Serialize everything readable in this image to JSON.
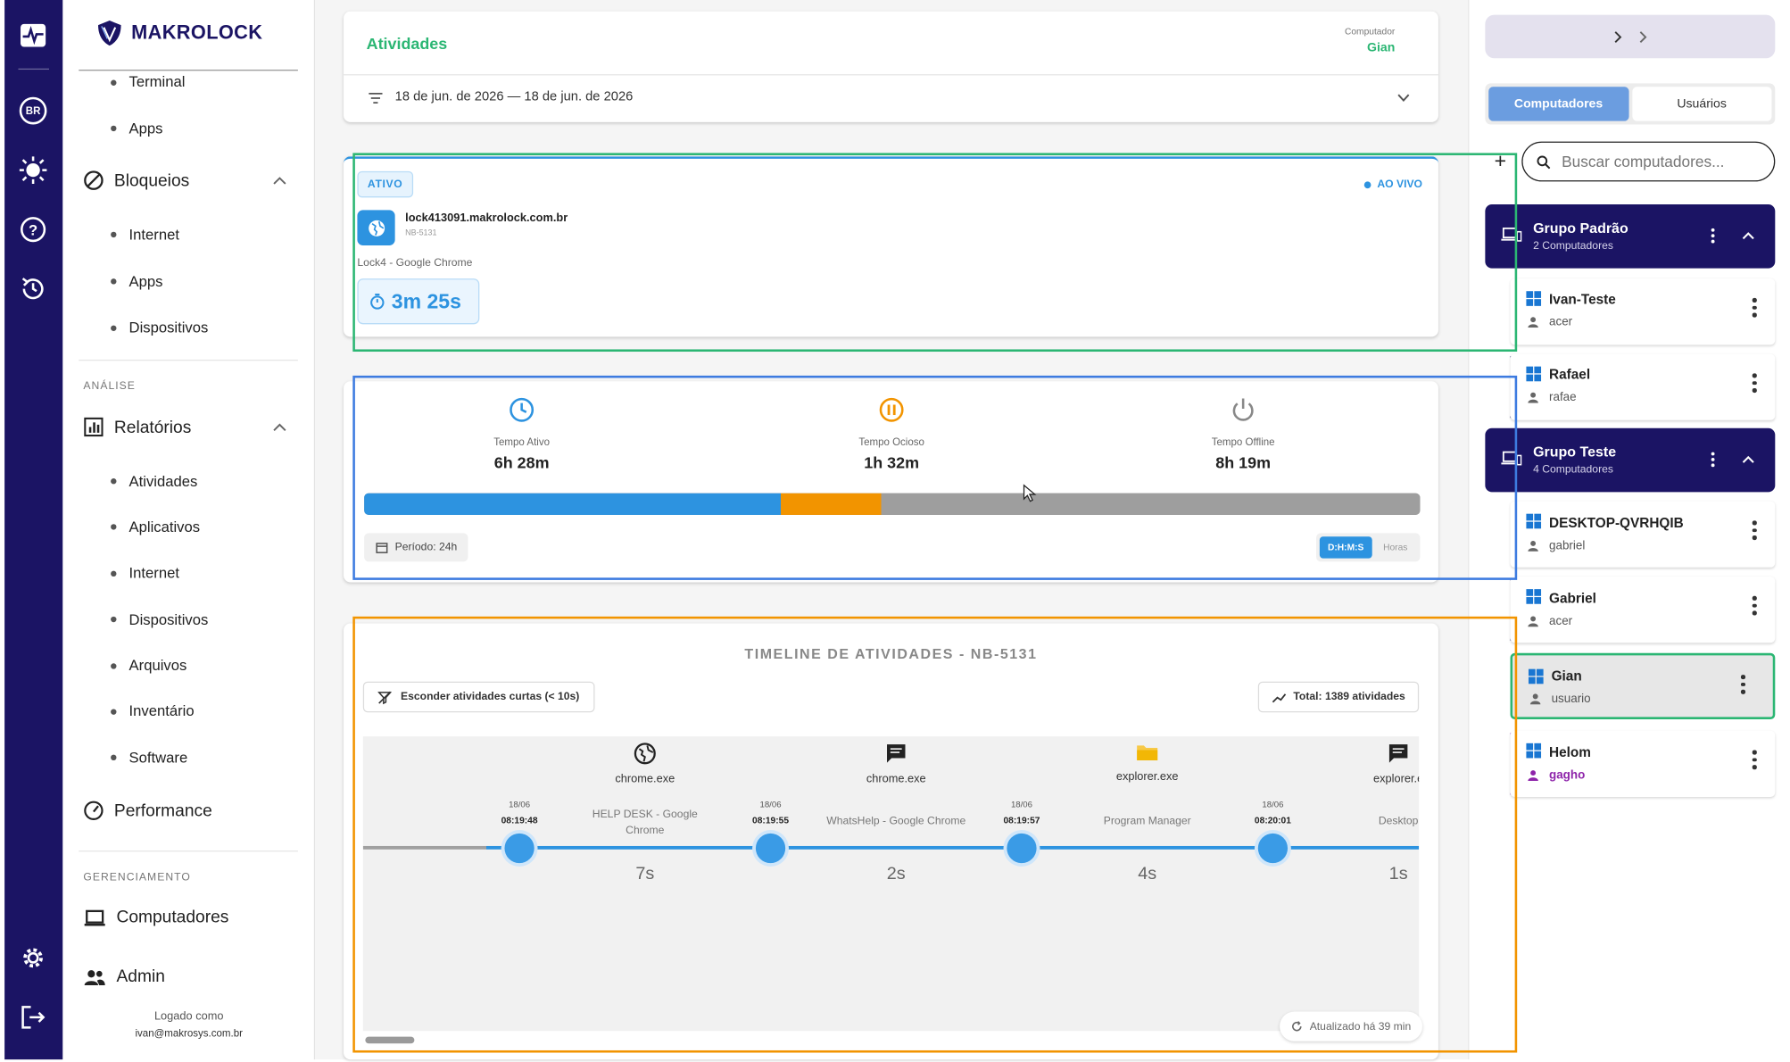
{
  "brand": {
    "name": "MAKROLOCK"
  },
  "rail": {
    "lang_badge": "BR"
  },
  "sidebar": {
    "items_top": [
      {
        "label": "Terminal"
      },
      {
        "label": "Apps"
      }
    ],
    "bloqueios": {
      "label": "Bloqueios",
      "children": [
        "Internet",
        "Apps",
        "Dispositivos"
      ]
    },
    "analise_caption": "ANÁLISE",
    "relatorios": {
      "label": "Relatórios",
      "children": [
        "Atividades",
        "Aplicativos",
        "Internet",
        "Dispositivos",
        "Arquivos",
        "Inventário",
        "Software"
      ]
    },
    "performance": "Performance",
    "gerenciamento_caption": "GERENCIAMENTO",
    "computadores": "Computadores",
    "admin": "Admin",
    "logged_as": "Logado como",
    "logged_email": "ivan@makrosys.com.br"
  },
  "header": {
    "title": "Atividades",
    "computer_caption": "Computador",
    "computer_name": "Gian",
    "date_range": "18 de jun. de 2026 — 18 de jun. de 2026"
  },
  "live": {
    "status_badge": "ATIVO",
    "live_label": "AO VIVO",
    "host": "lock413091.makrolock.com.br",
    "device": "NB-5131",
    "window_title": "Lock4 - Google Chrome",
    "elapsed": "3m 25s"
  },
  "summary": {
    "active": {
      "label": "Tempo Ativo",
      "value": "6h 28m",
      "color": "#2d93e0"
    },
    "idle": {
      "label": "Tempo Ocioso",
      "value": "1h 32m",
      "color": "#f29400"
    },
    "offline": {
      "label": "Tempo Offline",
      "value": "8h 19m",
      "color": "#9e9e9e"
    },
    "bar_fractions": {
      "active": 0.395,
      "idle": 0.095,
      "offline": 0.51
    },
    "period": "Período: 24h",
    "toggle": [
      "D:H:M:S",
      "Horas"
    ]
  },
  "timeline": {
    "title": "TIMELINE DE ATIVIDADES - NB-5131",
    "hide_short": "Esconder atividades curtas (< 10s)",
    "total": "Total: 1389 atividades",
    "events": [
      {
        "exe": "chrome.exe",
        "icon": "globe-icon",
        "date": "18/06",
        "time": "08:19:48",
        "window": "HELP DESK - Google Chrome",
        "duration": "7s"
      },
      {
        "exe": "chrome.exe",
        "icon": "chat-icon",
        "date": "18/06",
        "time": "08:19:55",
        "window": "WhatsHelp - Google Chrome",
        "duration": "2s"
      },
      {
        "exe": "explorer.exe",
        "icon": "folder-icon",
        "date": "18/06",
        "time": "08:19:57",
        "window": "Program Manager",
        "duration": "4s"
      },
      {
        "exe": "explorer.e",
        "icon": "chat-icon",
        "date": "18/06",
        "time": "08:20:01",
        "window": "Desktop",
        "duration": "1s"
      }
    ],
    "updated": "Atualizado há 39 min"
  },
  "right_panel": {
    "tabs": [
      "Computadores",
      "Usuários"
    ],
    "search_placeholder": "Buscar computadores...",
    "groups": [
      {
        "name": "Grupo Padrão",
        "count": "2 Computadores",
        "computers": [
          {
            "name": "Ivan-Teste",
            "user": "acer",
            "online": false
          },
          {
            "name": "Rafael",
            "user": "rafae",
            "online": true
          }
        ]
      },
      {
        "name": "Grupo Teste",
        "count": "4 Computadores",
        "computers": [
          {
            "name": "DESKTOP-QVRHQIB",
            "user": "gabriel",
            "online": false
          },
          {
            "name": "Gabriel",
            "user": "acer",
            "online": false
          },
          {
            "name": "Gian",
            "user": "usuario",
            "online": true,
            "selected": true
          },
          {
            "name": "Helom",
            "user": "gagho",
            "online": false,
            "user_color": "#8e24aa"
          }
        ]
      }
    ]
  }
}
